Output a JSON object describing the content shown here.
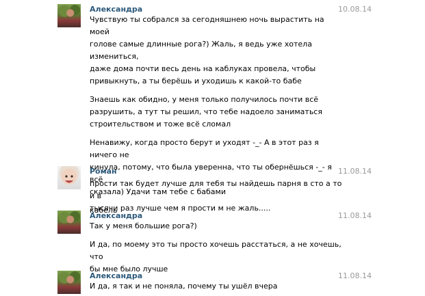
{
  "messages": [
    {
      "author": "Александра",
      "date": "10.08.14",
      "avatar": "user-photo-alexandra",
      "paragraphs": [
        [
          "Чувствую ты собрался за сегодняшнею ночь вырастить на моей",
          "голове самые длинные рога?) Жаль, я ведь уже хотела измениться,",
          "даже дома почти весь день на каблуках провела, чтобы",
          "привыкнуть, а ты берёшь и уходишь к какой-то бабе"
        ],
        [
          "Знаешь как обидно, у меня только получилось почти всё",
          "разрушить, а тут ты решил, что тебе надоело заниматься",
          "строительством и тоже всё сломал"
        ],
        [
          "Ненавижу, когда просто берут и уходят -_- А в этот раз я ничего не",
          "кинула, потому, что была уверенна, что ты обернёшься -_- я всё",
          "сказала) Удачи там тебе с бабами"
        ],
        [
          "кабель"
        ]
      ]
    },
    {
      "author": "Роман",
      "date": "11.08.14",
      "avatar": "user-photo-roman",
      "paragraphs": [
        [
          "прости так будет лучше для тебя ты найдешь парня в сто а то и в",
          "тысячи раз лучше чем я прости м не жаль....."
        ]
      ]
    },
    {
      "author": "Александра",
      "date": "11.08.14",
      "avatar": "user-photo-alexandra",
      "paragraphs": [
        [
          "Так у меня большие рога?)"
        ],
        [
          "И да, по моему это ты просто хочешь расстаться, а не хочешь, что",
          "бы мне было лучше"
        ]
      ]
    },
    {
      "author": "Александра",
      "date": "11.08.14",
      "avatar": "user-photo-alexandra",
      "paragraphs": [
        [
          "И да, я так и не поняла, почему ты ушёл вчера"
        ]
      ]
    }
  ]
}
